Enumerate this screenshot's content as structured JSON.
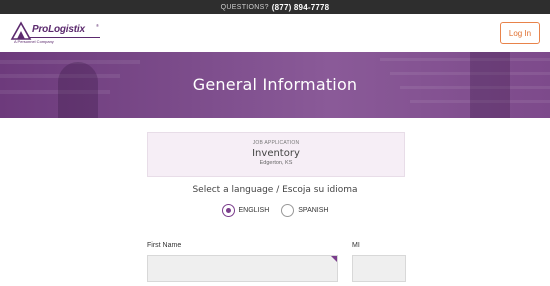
{
  "topbar": {
    "questions_label": "QUESTIONS?",
    "phone": "(877) 894-7778"
  },
  "header": {
    "logo_text": "ProLogistix",
    "logo_mark": "®",
    "logo_tagline": "A Personnel Company",
    "login_label": "Log In"
  },
  "hero": {
    "title": "General Information"
  },
  "job": {
    "label": "JOB APPLICATION",
    "title": "Inventory",
    "location": "Edgerton, KS"
  },
  "language": {
    "prompt": "Select a language / Escoja su idioma",
    "options": [
      {
        "label": "ENGLISH",
        "selected": true
      },
      {
        "label": "SPANISH",
        "selected": false
      }
    ]
  },
  "form": {
    "first_name_label": "First Name",
    "mi_label": "MI",
    "first_name_value": "",
    "mi_value": ""
  },
  "colors": {
    "brand": "#7a3d8c",
    "accent": "#e07030",
    "topbar": "#2e2e2e"
  }
}
